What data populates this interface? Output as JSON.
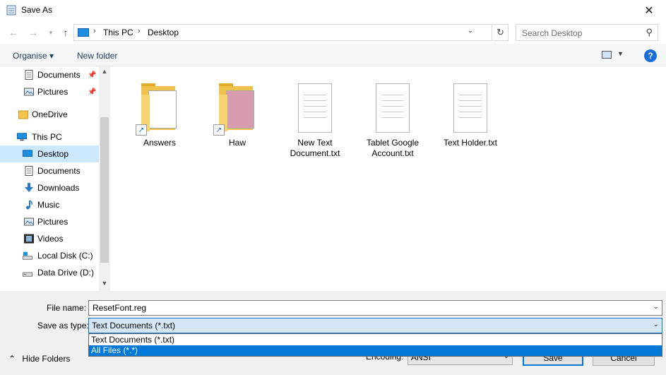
{
  "window": {
    "title": "Save As"
  },
  "address": {
    "crumbs": [
      "This PC",
      "Desktop"
    ],
    "search_placeholder": "Search Desktop"
  },
  "toolbar": {
    "organise_label": "Organise ▾",
    "new_folder_label": "New folder",
    "help_label": "?"
  },
  "sidebar": {
    "items": [
      {
        "label": "Documents",
        "icon": "documents-icon",
        "pinned": true
      },
      {
        "label": "Pictures",
        "icon": "pictures-icon",
        "pinned": true
      },
      {
        "label": "OneDrive",
        "icon": "folder-icon"
      },
      {
        "label": "This PC",
        "icon": "pc-icon"
      },
      {
        "label": "Desktop",
        "icon": "desktop-icon",
        "selected": true
      },
      {
        "label": "Documents",
        "icon": "documents-icon"
      },
      {
        "label": "Downloads",
        "icon": "download-icon"
      },
      {
        "label": "Music",
        "icon": "music-icon"
      },
      {
        "label": "Pictures",
        "icon": "pictures-icon"
      },
      {
        "label": "Videos",
        "icon": "videos-icon"
      },
      {
        "label": "Local Disk (C:)",
        "icon": "drive-icon"
      },
      {
        "label": "Data Drive (D:)",
        "icon": "drive-icon"
      }
    ]
  },
  "files": [
    {
      "label": "Answers",
      "kind": "folder-shortcut"
    },
    {
      "label": "Haw",
      "kind": "folder-shortcut"
    },
    {
      "label": "New Text Document.txt",
      "kind": "text-file"
    },
    {
      "label": "Tablet Google Account.txt",
      "kind": "text-file"
    },
    {
      "label": "Text Holder.txt",
      "kind": "text-file"
    }
  ],
  "form": {
    "file_name_label": "File name:",
    "file_name_value": "ResetFont.reg",
    "save_type_label": "Save as type:",
    "save_type_value": "Text Documents (*.txt)",
    "type_options": [
      "Text Documents (*.txt)",
      "All Files  (*.*)"
    ],
    "highlighted_option": 1,
    "encoding_label": "Encoding:",
    "encoding_value": "ANSI",
    "hide_folders_label": "Hide Folders",
    "save_label": "Save",
    "cancel_label": "Cancel"
  }
}
